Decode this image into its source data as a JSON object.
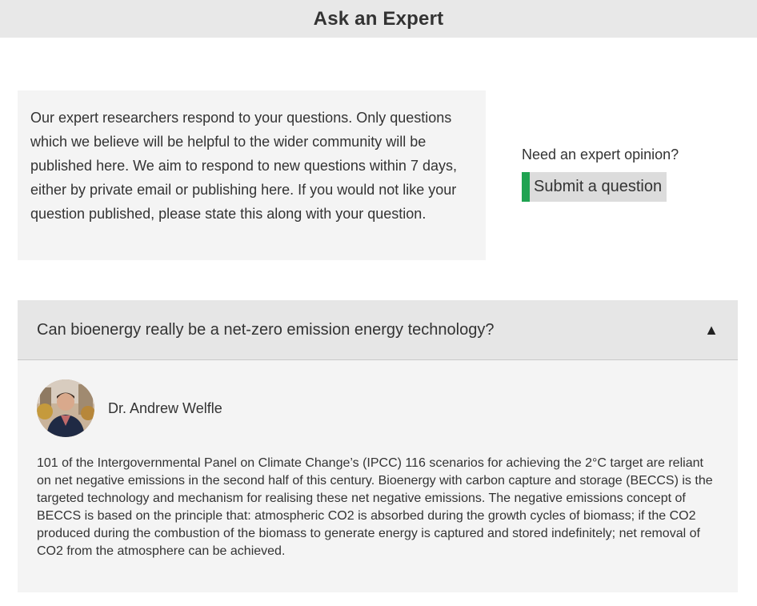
{
  "header": {
    "title": "Ask an Expert"
  },
  "intro": {
    "text": "Our expert researchers respond to your questions. Only questions which we believe will be helpful to the wider community will be published here. We aim to respond to new questions within 7 days, either by private email or publishing here. If you would not like your question published, please state this along with your question."
  },
  "cta": {
    "label": "Need an expert opinion?",
    "button_label": "Submit a question",
    "button_accent": "#1fa351"
  },
  "faq": {
    "question": "Can bioenergy really be a net-zero emission energy technology?",
    "toggle_icon": "▲",
    "expert_name": "Dr. Andrew Welfle",
    "answer": "101 of the Intergovernmental Panel on Climate Change’s (IPCC) 116 scenarios for achieving the 2°C target are reliant on net negative emissions in the second half of this century. Bioenergy with carbon capture and storage (BECCS) is the targeted technology and mechanism for realising these net negative emissions. The negative emissions concept of BECCS is based on the principle that: atmospheric CO2 is absorbed during the growth cycles of biomass; if the CO2 produced during the combustion of the biomass to generate energy is captured and stored indefinitely; net removal of CO2 from the atmosphere can be achieved."
  },
  "colors": {
    "header_bg": "#e8e8e8",
    "panel_bg": "#f4f4f4",
    "question_bg": "#e6e6e6",
    "button_bg": "#dcdcdc"
  }
}
